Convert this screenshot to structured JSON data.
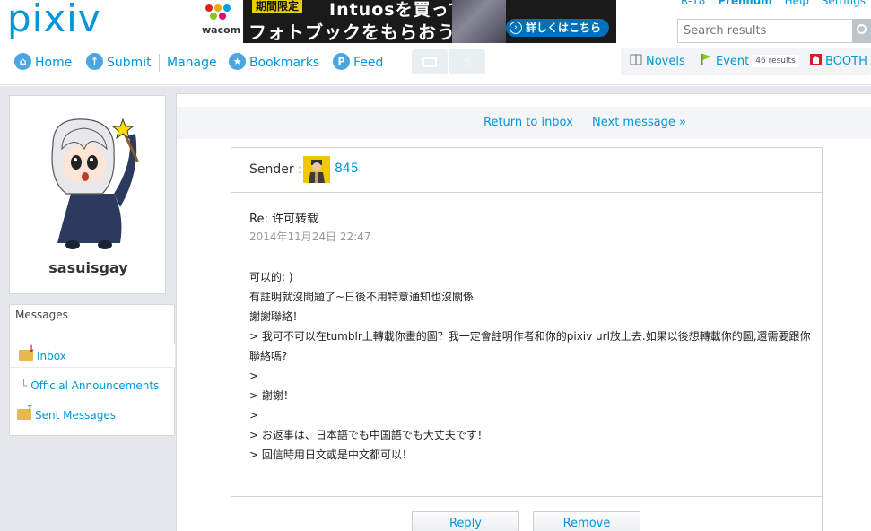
{
  "header": {
    "logo": "pixiv",
    "top_links": [
      "R-18",
      "Premium",
      "Help",
      "Settings"
    ],
    "search": {
      "placeholder": "Search results"
    },
    "banner": {
      "brand": "wacom",
      "limited": "期間限定",
      "line1": "Intuosを買って",
      "line2": "フォトブックをもらおう!",
      "cta": "詳しくはこちら"
    },
    "nav": [
      {
        "label": "Home",
        "icon": "home-icon"
      },
      {
        "label": "Submit",
        "icon": "upload-icon"
      },
      {
        "label": "Manage"
      },
      {
        "label": "Bookmarks",
        "icon": "star-icon"
      },
      {
        "label": "Feed",
        "icon": "feed-icon"
      }
    ],
    "right_nav": {
      "novels": "Novels",
      "event": "Event",
      "event_badge": "46 results",
      "booth": "BOOTH"
    }
  },
  "profile": {
    "username": "sasuisgay"
  },
  "messages_menu": {
    "title": "Messages",
    "items": [
      "Inbox",
      "Official Announcements",
      "Sent Messages"
    ]
  },
  "message_nav": {
    "back": "Return to inbox",
    "next": "Next message »"
  },
  "message": {
    "sender_label": "Sender :",
    "sender_name": "845",
    "subject": "Re: 许可转载",
    "date": "2014年11月24日 22:47",
    "body": [
      "可以的: )",
      "有註明就沒問題了~日後不用特意通知也沒關係",
      "謝謝聯絡！",
      "",
      "> 我可不可以在tumblr上轉載你畫的圖？我一定會註明作者和你的pixiv url放上去.如果以後想轉載你的圖,還需要跟你聯絡嗎?",
      ">",
      "> 謝謝！",
      ">",
      "> お返事は、日本語でも中国語でも大丈夫です！",
      "> 回信時用日文或是中文都可以！"
    ],
    "reply_label": "Reply",
    "remove_label": "Remove"
  }
}
